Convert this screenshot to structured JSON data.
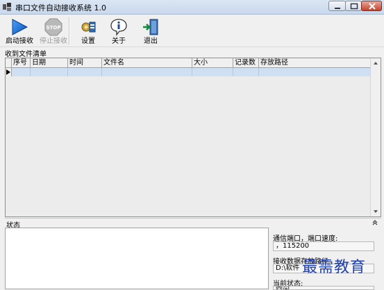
{
  "window": {
    "title": "串口文件自动接收系统 1.0",
    "titlebar_color": "#c9d8ec",
    "close_color": "#c2452d"
  },
  "toolbar": {
    "start_label": "启动接收",
    "start_icon": "play-triangle-icon",
    "stop_label": "停止接收",
    "stop_icon": "stop-sign-icon",
    "settings_label": "设置",
    "settings_icon": "gear-settings-icon",
    "about_label": "关于",
    "about_icon": "info-icon",
    "exit_label": "退出",
    "exit_icon": "exit-door-icon"
  },
  "file_list": {
    "caption": "收到文件清单",
    "columns": [
      "序号",
      "日期",
      "时间",
      "文件名",
      "大小",
      "记录数",
      "存放路径"
    ],
    "selected_row_color": "#cfe0f4"
  },
  "status": {
    "caption": "状态",
    "port_label": "通信端口，端口速度:",
    "port_value": "，115200",
    "path_label": "接收数据存放路径",
    "path_value": "D:\\软件",
    "state_label": "当前状态:",
    "state_value": "空闲"
  },
  "watermark": "最需教育",
  "colors": {
    "accent_blue": "#1e6fd1",
    "watermark_blue": "#1d3fb0"
  }
}
